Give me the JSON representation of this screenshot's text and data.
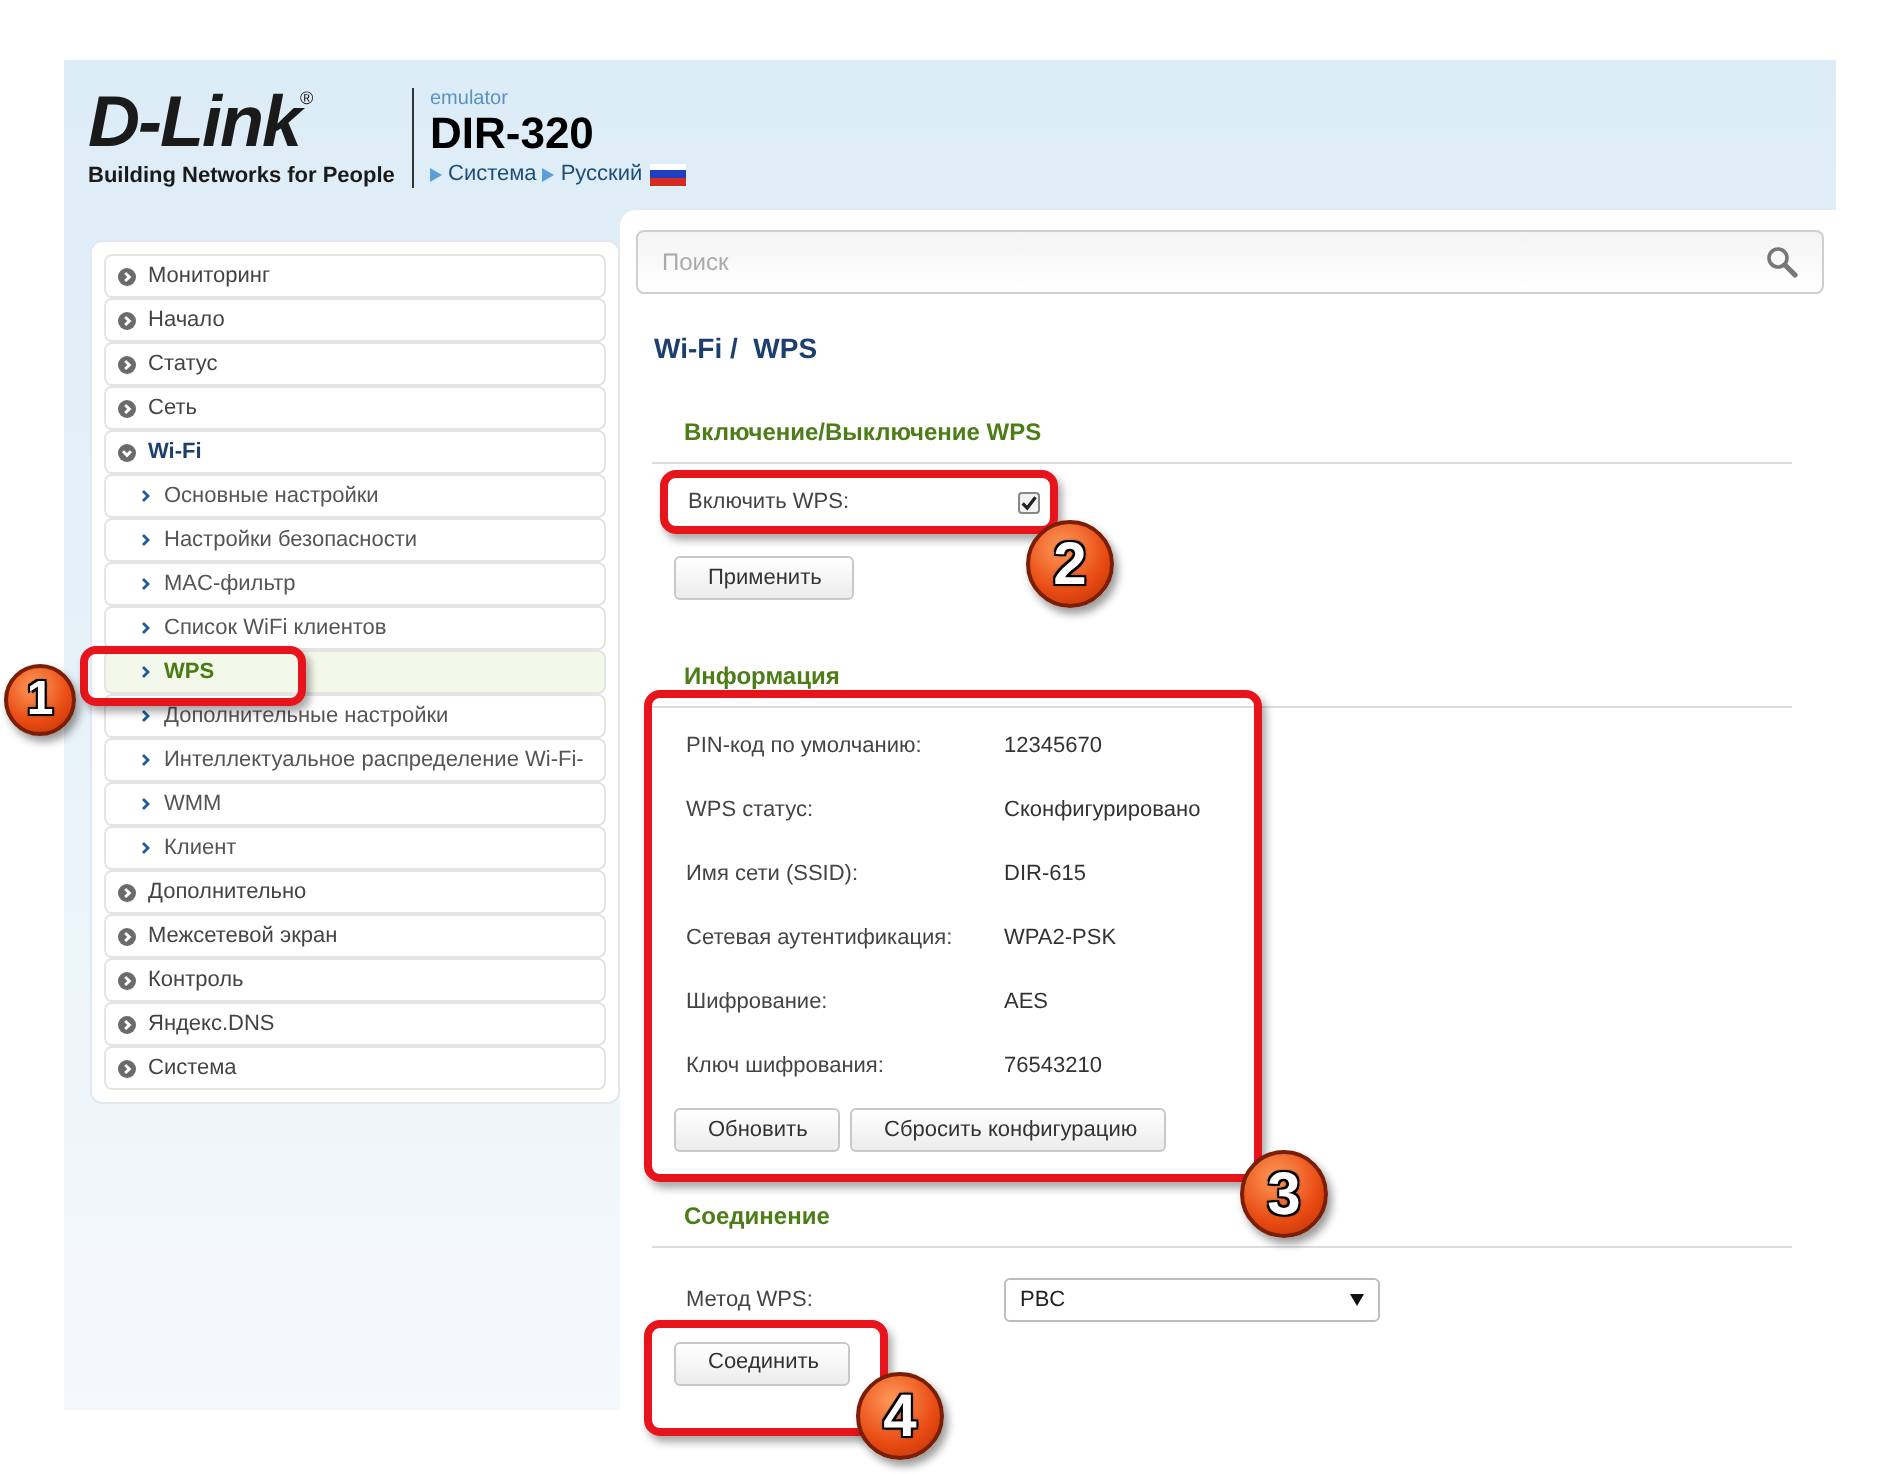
{
  "header": {
    "logo": "D-Link",
    "logo_mark": "®",
    "tagline": "Building Networks for People",
    "emulator": "emulator",
    "model": "DIR-320",
    "breadcrumb": [
      {
        "label": "Система"
      },
      {
        "label": "Русский"
      }
    ]
  },
  "sidebar": {
    "items": [
      {
        "label": "Мониторинг",
        "expanded": false
      },
      {
        "label": "Начало",
        "expanded": false
      },
      {
        "label": "Статус",
        "expanded": false
      },
      {
        "label": "Сеть",
        "expanded": false
      },
      {
        "label": "Wi-Fi",
        "expanded": true,
        "children": [
          {
            "label": "Основные настройки",
            "selected": false
          },
          {
            "label": "Настройки безопасности",
            "selected": false
          },
          {
            "label": "MAC-фильтр",
            "selected": false
          },
          {
            "label": "Список WiFi клиентов",
            "selected": false
          },
          {
            "label": "WPS",
            "selected": true
          },
          {
            "label": "Дополнительные настройки",
            "selected": false
          },
          {
            "label": "Интеллектуальное распределение Wi-Fi-",
            "selected": false
          },
          {
            "label": "WMM",
            "selected": false
          },
          {
            "label": "Клиент",
            "selected": false
          }
        ]
      },
      {
        "label": "Дополнительно",
        "expanded": false
      },
      {
        "label": "Межсетевой экран",
        "expanded": false
      },
      {
        "label": "Контроль",
        "expanded": false
      },
      {
        "label": "Яндекс.DNS",
        "expanded": false
      },
      {
        "label": "Система",
        "expanded": false
      }
    ]
  },
  "search": {
    "placeholder": "Поиск"
  },
  "page_title": "Wi-Fi /  WPS",
  "wps_toggle": {
    "title": "Включение/Выключение WPS",
    "label": "Включить WPS:",
    "checked": true,
    "button": "Применить"
  },
  "information": {
    "title": "Информация",
    "rows": [
      {
        "label": "PIN-код по умолчанию:",
        "value": "12345670"
      },
      {
        "label": "WPS статус:",
        "value": "Сконфигурировано"
      },
      {
        "label": "Имя сети (SSID):",
        "value": "DIR-615"
      },
      {
        "label": "Сетевая аутентификация:",
        "value": "WPA2-PSK"
      },
      {
        "label": "Шифрование:",
        "value": "AES"
      },
      {
        "label": "Ключ шифрования:",
        "value": "76543210"
      }
    ],
    "buttons": [
      "Обновить",
      "Сбросить конфигурацию"
    ]
  },
  "connection": {
    "title": "Соединение",
    "method_label": "Метод WPS:",
    "method_value": "PBC",
    "button": "Соединить"
  },
  "callouts": [
    {
      "number": "1"
    },
    {
      "number": "2"
    },
    {
      "number": "3"
    },
    {
      "number": "4"
    }
  ]
}
